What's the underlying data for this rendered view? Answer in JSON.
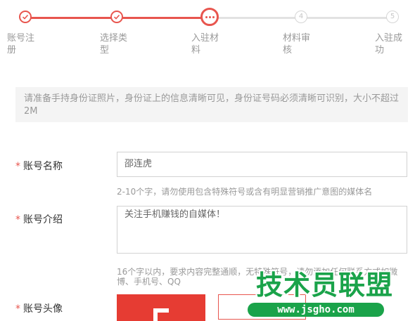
{
  "stepper": {
    "steps": [
      {
        "label": "账号注册",
        "state": "done",
        "marker": "check-icon"
      },
      {
        "label": "选择类型",
        "state": "done",
        "marker": "check-icon"
      },
      {
        "label": "入驻材料",
        "state": "active",
        "marker": "ellipsis-icon"
      },
      {
        "label": "材料审核",
        "state": "pending",
        "marker": "4"
      },
      {
        "label": "入驻成功",
        "state": "pending",
        "marker": "5"
      }
    ],
    "accent_color": "#e8554e",
    "pending_color": "#e2e2e2"
  },
  "notice": {
    "text": "请准备手持身份证照片，身份证上的信息清晰可见，身份证号码必须清晰可识别，大小不超过2M"
  },
  "form": {
    "required_mark": "*",
    "account_name": {
      "label": "账号名称",
      "value": "邵连虎",
      "hint": "2-10个字，请勿使用包含特殊符号或含有明显营销推广意图的媒体名"
    },
    "account_intro": {
      "label": "账号介绍",
      "value": "关注手机赚钱的自媒体！",
      "hint": "16个字以内，要求内容完整通顺，无特殊符号，请勿添加任何联系方式如微博、手机号、QQ"
    },
    "account_avatar": {
      "label": "账号头像"
    }
  },
  "watermark": {
    "title": "技术员联盟",
    "url": "www.jsgho.com",
    "color": "#1aa34a"
  }
}
